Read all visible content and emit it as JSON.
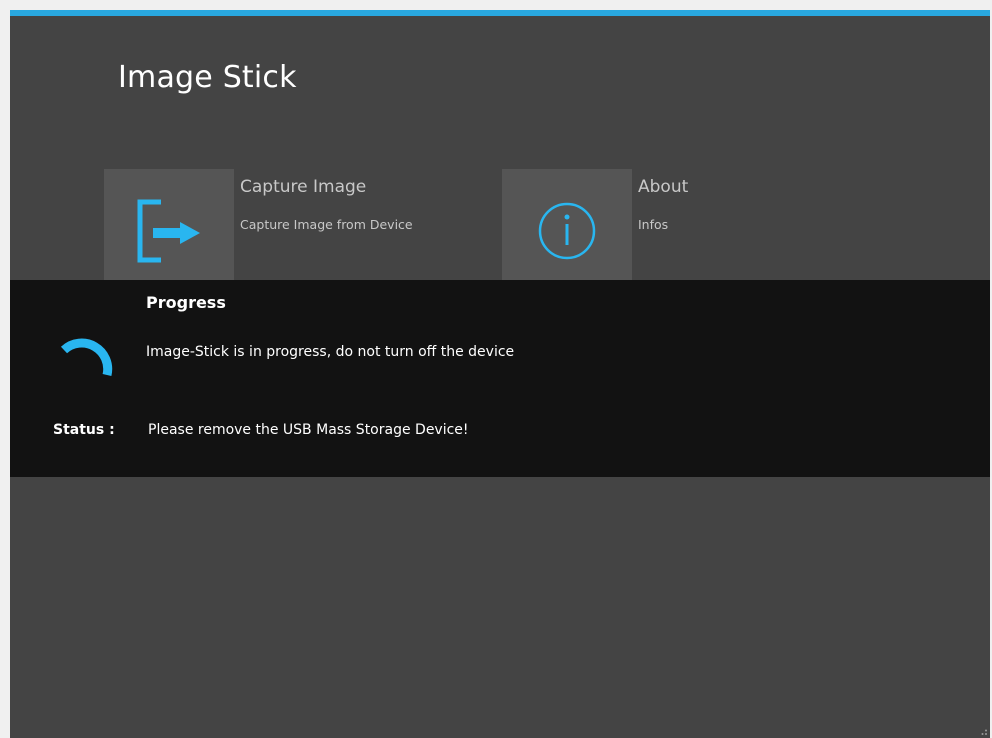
{
  "app": {
    "title": "Image Stick",
    "accent_color": "#29a8e0",
    "background_color": "#444444"
  },
  "tiles": [
    {
      "title": "Capture Image",
      "subtitle": "Capture Image from Device",
      "icon": "sign-out-arrow-icon"
    },
    {
      "title": "About",
      "subtitle": "Infos",
      "icon": "info-circle-icon"
    }
  ],
  "progress": {
    "heading": "Progress",
    "message": "Image-Stick is in progress, do not turn off the device",
    "spinner_icon": "spinner-icon",
    "status_label": "Status :",
    "status_value": "Please remove the USB Mass Storage Device!"
  }
}
